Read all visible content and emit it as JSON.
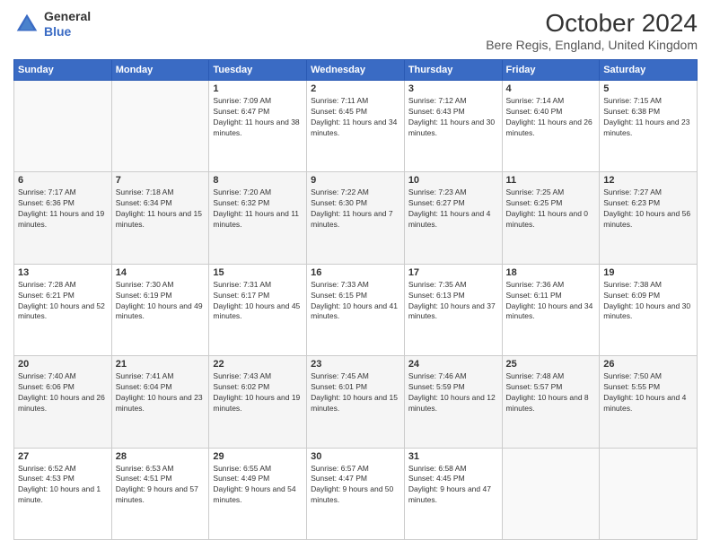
{
  "header": {
    "logo": {
      "line1": "General",
      "line2": "Blue"
    },
    "title": "October 2024",
    "subtitle": "Bere Regis, England, United Kingdom"
  },
  "calendar": {
    "days_of_week": [
      "Sunday",
      "Monday",
      "Tuesday",
      "Wednesday",
      "Thursday",
      "Friday",
      "Saturday"
    ],
    "weeks": [
      [
        {
          "day": "",
          "empty": true
        },
        {
          "day": "",
          "empty": true
        },
        {
          "day": "1",
          "sunrise": "Sunrise: 7:09 AM",
          "sunset": "Sunset: 6:47 PM",
          "daylight": "Daylight: 11 hours and 38 minutes."
        },
        {
          "day": "2",
          "sunrise": "Sunrise: 7:11 AM",
          "sunset": "Sunset: 6:45 PM",
          "daylight": "Daylight: 11 hours and 34 minutes."
        },
        {
          "day": "3",
          "sunrise": "Sunrise: 7:12 AM",
          "sunset": "Sunset: 6:43 PM",
          "daylight": "Daylight: 11 hours and 30 minutes."
        },
        {
          "day": "4",
          "sunrise": "Sunrise: 7:14 AM",
          "sunset": "Sunset: 6:40 PM",
          "daylight": "Daylight: 11 hours and 26 minutes."
        },
        {
          "day": "5",
          "sunrise": "Sunrise: 7:15 AM",
          "sunset": "Sunset: 6:38 PM",
          "daylight": "Daylight: 11 hours and 23 minutes."
        }
      ],
      [
        {
          "day": "6",
          "sunrise": "Sunrise: 7:17 AM",
          "sunset": "Sunset: 6:36 PM",
          "daylight": "Daylight: 11 hours and 19 minutes."
        },
        {
          "day": "7",
          "sunrise": "Sunrise: 7:18 AM",
          "sunset": "Sunset: 6:34 PM",
          "daylight": "Daylight: 11 hours and 15 minutes."
        },
        {
          "day": "8",
          "sunrise": "Sunrise: 7:20 AM",
          "sunset": "Sunset: 6:32 PM",
          "daylight": "Daylight: 11 hours and 11 minutes."
        },
        {
          "day": "9",
          "sunrise": "Sunrise: 7:22 AM",
          "sunset": "Sunset: 6:30 PM",
          "daylight": "Daylight: 11 hours and 7 minutes."
        },
        {
          "day": "10",
          "sunrise": "Sunrise: 7:23 AM",
          "sunset": "Sunset: 6:27 PM",
          "daylight": "Daylight: 11 hours and 4 minutes."
        },
        {
          "day": "11",
          "sunrise": "Sunrise: 7:25 AM",
          "sunset": "Sunset: 6:25 PM",
          "daylight": "Daylight: 11 hours and 0 minutes."
        },
        {
          "day": "12",
          "sunrise": "Sunrise: 7:27 AM",
          "sunset": "Sunset: 6:23 PM",
          "daylight": "Daylight: 10 hours and 56 minutes."
        }
      ],
      [
        {
          "day": "13",
          "sunrise": "Sunrise: 7:28 AM",
          "sunset": "Sunset: 6:21 PM",
          "daylight": "Daylight: 10 hours and 52 minutes."
        },
        {
          "day": "14",
          "sunrise": "Sunrise: 7:30 AM",
          "sunset": "Sunset: 6:19 PM",
          "daylight": "Daylight: 10 hours and 49 minutes."
        },
        {
          "day": "15",
          "sunrise": "Sunrise: 7:31 AM",
          "sunset": "Sunset: 6:17 PM",
          "daylight": "Daylight: 10 hours and 45 minutes."
        },
        {
          "day": "16",
          "sunrise": "Sunrise: 7:33 AM",
          "sunset": "Sunset: 6:15 PM",
          "daylight": "Daylight: 10 hours and 41 minutes."
        },
        {
          "day": "17",
          "sunrise": "Sunrise: 7:35 AM",
          "sunset": "Sunset: 6:13 PM",
          "daylight": "Daylight: 10 hours and 37 minutes."
        },
        {
          "day": "18",
          "sunrise": "Sunrise: 7:36 AM",
          "sunset": "Sunset: 6:11 PM",
          "daylight": "Daylight: 10 hours and 34 minutes."
        },
        {
          "day": "19",
          "sunrise": "Sunrise: 7:38 AM",
          "sunset": "Sunset: 6:09 PM",
          "daylight": "Daylight: 10 hours and 30 minutes."
        }
      ],
      [
        {
          "day": "20",
          "sunrise": "Sunrise: 7:40 AM",
          "sunset": "Sunset: 6:06 PM",
          "daylight": "Daylight: 10 hours and 26 minutes."
        },
        {
          "day": "21",
          "sunrise": "Sunrise: 7:41 AM",
          "sunset": "Sunset: 6:04 PM",
          "daylight": "Daylight: 10 hours and 23 minutes."
        },
        {
          "day": "22",
          "sunrise": "Sunrise: 7:43 AM",
          "sunset": "Sunset: 6:02 PM",
          "daylight": "Daylight: 10 hours and 19 minutes."
        },
        {
          "day": "23",
          "sunrise": "Sunrise: 7:45 AM",
          "sunset": "Sunset: 6:01 PM",
          "daylight": "Daylight: 10 hours and 15 minutes."
        },
        {
          "day": "24",
          "sunrise": "Sunrise: 7:46 AM",
          "sunset": "Sunset: 5:59 PM",
          "daylight": "Daylight: 10 hours and 12 minutes."
        },
        {
          "day": "25",
          "sunrise": "Sunrise: 7:48 AM",
          "sunset": "Sunset: 5:57 PM",
          "daylight": "Daylight: 10 hours and 8 minutes."
        },
        {
          "day": "26",
          "sunrise": "Sunrise: 7:50 AM",
          "sunset": "Sunset: 5:55 PM",
          "daylight": "Daylight: 10 hours and 4 minutes."
        }
      ],
      [
        {
          "day": "27",
          "sunrise": "Sunrise: 6:52 AM",
          "sunset": "Sunset: 4:53 PM",
          "daylight": "Daylight: 10 hours and 1 minute."
        },
        {
          "day": "28",
          "sunrise": "Sunrise: 6:53 AM",
          "sunset": "Sunset: 4:51 PM",
          "daylight": "Daylight: 9 hours and 57 minutes."
        },
        {
          "day": "29",
          "sunrise": "Sunrise: 6:55 AM",
          "sunset": "Sunset: 4:49 PM",
          "daylight": "Daylight: 9 hours and 54 minutes."
        },
        {
          "day": "30",
          "sunrise": "Sunrise: 6:57 AM",
          "sunset": "Sunset: 4:47 PM",
          "daylight": "Daylight: 9 hours and 50 minutes."
        },
        {
          "day": "31",
          "sunrise": "Sunrise: 6:58 AM",
          "sunset": "Sunset: 4:45 PM",
          "daylight": "Daylight: 9 hours and 47 minutes."
        },
        {
          "day": "",
          "empty": true
        },
        {
          "day": "",
          "empty": true
        }
      ]
    ]
  }
}
